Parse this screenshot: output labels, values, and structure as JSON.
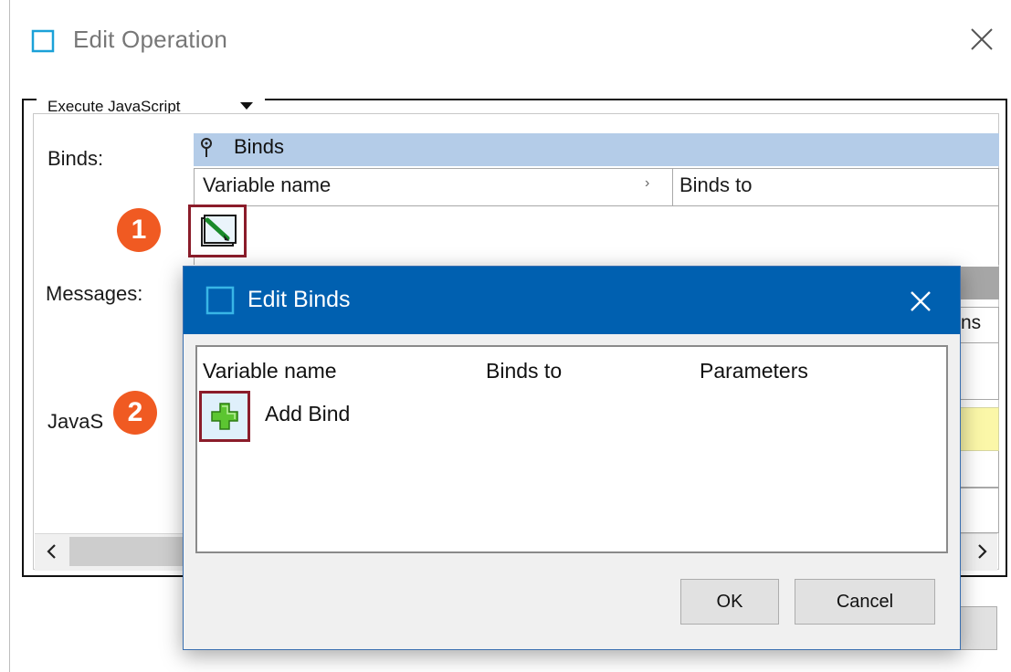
{
  "outer_window": {
    "title": "Edit Operation",
    "group_label": "Execute JavaScript",
    "labels": {
      "binds": "Binds:",
      "messages": "Messages:",
      "javascript": "JavaS"
    },
    "binds_table": {
      "title": "Binds",
      "columns": [
        "Variable name",
        "Binds to"
      ]
    },
    "messages_peek_text": "ns"
  },
  "callouts": [
    "1",
    "2"
  ],
  "dialog": {
    "title": "Edit Binds",
    "columns": [
      "Variable name",
      "Binds to",
      "Parameters"
    ],
    "add_bind_label": "Add Bind",
    "ok_label": "OK",
    "cancel_label": "Cancel"
  },
  "colors": {
    "dialog_titlebar": "#0060b0",
    "binds_header": "#b4cce8",
    "callout": "#f05a22",
    "highlight_border": "#8b1c2a",
    "js_editor_bg": "#fbf7a8"
  },
  "icons": {
    "outer_title": "window-icon",
    "close": "close-icon",
    "group_dropdown": "dropdown-triangle-icon",
    "pin": "pin-icon",
    "edit_binds": "edit-pencil-icon",
    "add_bind": "add-plus-icon",
    "dialog_title": "window-icon",
    "scroll_left": "chevron-left-icon",
    "scroll_right": "chevron-right-icon"
  }
}
